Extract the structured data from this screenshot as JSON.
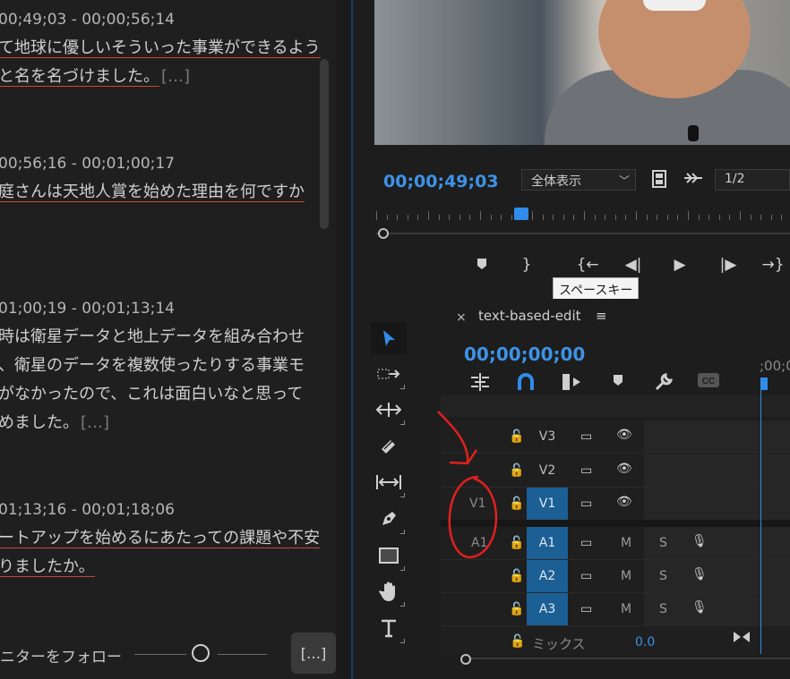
{
  "transcript": {
    "segments": [
      {
        "timecode": "00;49;03 - 00;00;56;14",
        "lines": [
          {
            "text": "て地球に優しいそういった事業ができるよう",
            "u": true
          },
          {
            "text": "と名を名づけました。",
            "u": true,
            "ellipsis": "[…]"
          }
        ]
      },
      {
        "timecode": "00;56;16 - 00;01;00;17",
        "lines": [
          {
            "text": "庭さんは天地人賞を始めた理由を何ですか",
            "u": true
          }
        ]
      },
      {
        "timecode": "01;00;19 - 00;01;13;14",
        "lines": [
          {
            "text": "時は衛星データと地上データを組み合わせ",
            "u": false
          },
          {
            "text": "、衛星のデータを複数使ったりする事業モ",
            "u": false
          },
          {
            "text": "がなかったので、これは面白いなと思って",
            "u": false
          },
          {
            "text": "めました。",
            "u": false,
            "ellipsis": "[…]"
          }
        ]
      },
      {
        "timecode": "01;13;16 - 00;01;18;06",
        "lines": [
          {
            "text": "ートアップを始めるにあたっての課題や不安",
            "u": true
          },
          {
            "text": "りましたか。",
            "u": true
          }
        ]
      }
    ],
    "follow_label": "ニターをフォロー",
    "more_button": "[…]"
  },
  "monitor": {
    "timecode": "00;00;49;03",
    "fit_option": "全体表示",
    "resolution": "1/2",
    "tooltip": "スペースキー",
    "transport": {
      "marker": "◆",
      "out": "}",
      "step_in": "{←",
      "step_back": "◀|",
      "play": "▶",
      "step_fwd": "|▶",
      "step_out": "→}"
    }
  },
  "tools": [
    "selection-tool",
    "track-select-tool",
    "ripple-edit-tool",
    "razor-tool",
    "slip-tool",
    "pen-tool",
    "rectangle-tool",
    "hand-tool",
    "type-tool"
  ],
  "timeline": {
    "close": "×",
    "title": "text-based-edit",
    "menu": "≡",
    "timecode": "00;00;00;00",
    "ruler_label": ";00;0",
    "tracks": [
      {
        "source": "",
        "name": "V3",
        "type": "video",
        "on": false
      },
      {
        "source": "",
        "name": "V2",
        "type": "video",
        "on": false
      },
      {
        "source": "V1",
        "name": "V1",
        "type": "video",
        "on": true
      },
      {
        "source": "A1",
        "name": "A1",
        "type": "audio",
        "on": true
      },
      {
        "source": "",
        "name": "A2",
        "type": "audio",
        "on": true
      },
      {
        "source": "",
        "name": "A3",
        "type": "audio",
        "on": true
      }
    ],
    "mix_label": "ミックス",
    "mix_value": "0.0",
    "mute": "M",
    "solo": "S"
  },
  "colors": {
    "accent": "#2f8cea",
    "track_on": "#1b5f95",
    "annotation": "#e0201f"
  }
}
